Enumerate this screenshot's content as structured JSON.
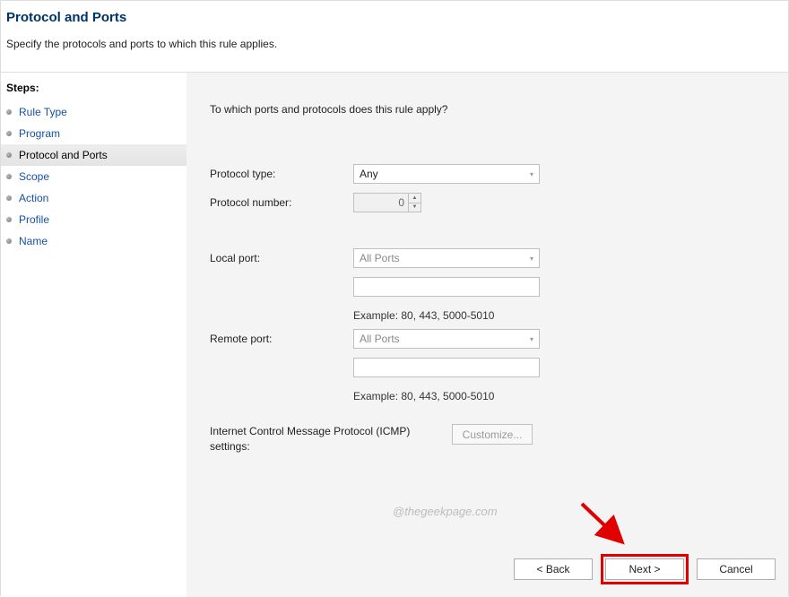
{
  "header": {
    "title": "Protocol and Ports",
    "description": "Specify the protocols and ports to which this rule applies."
  },
  "sidebar": {
    "steps_label": "Steps:",
    "items": [
      {
        "label": "Rule Type",
        "current": false
      },
      {
        "label": "Program",
        "current": false
      },
      {
        "label": "Protocol and Ports",
        "current": true
      },
      {
        "label": "Scope",
        "current": false
      },
      {
        "label": "Action",
        "current": false
      },
      {
        "label": "Profile",
        "current": false
      },
      {
        "label": "Name",
        "current": false
      }
    ]
  },
  "content": {
    "question": "To which ports and protocols does this rule apply?",
    "protocol_type_label": "Protocol type:",
    "protocol_type_value": "Any",
    "protocol_number_label": "Protocol number:",
    "protocol_number_value": "0",
    "local_port_label": "Local port:",
    "local_port_value": "All Ports",
    "local_port_example": "Example: 80, 443, 5000-5010",
    "remote_port_label": "Remote port:",
    "remote_port_value": "All Ports",
    "remote_port_example": "Example: 80, 443, 5000-5010",
    "icmp_label": "Internet Control Message Protocol (ICMP) settings:",
    "customize_label": "Customize..."
  },
  "buttons": {
    "back": "< Back",
    "next": "Next >",
    "cancel": "Cancel"
  },
  "watermark": "@thegeekpage.com"
}
